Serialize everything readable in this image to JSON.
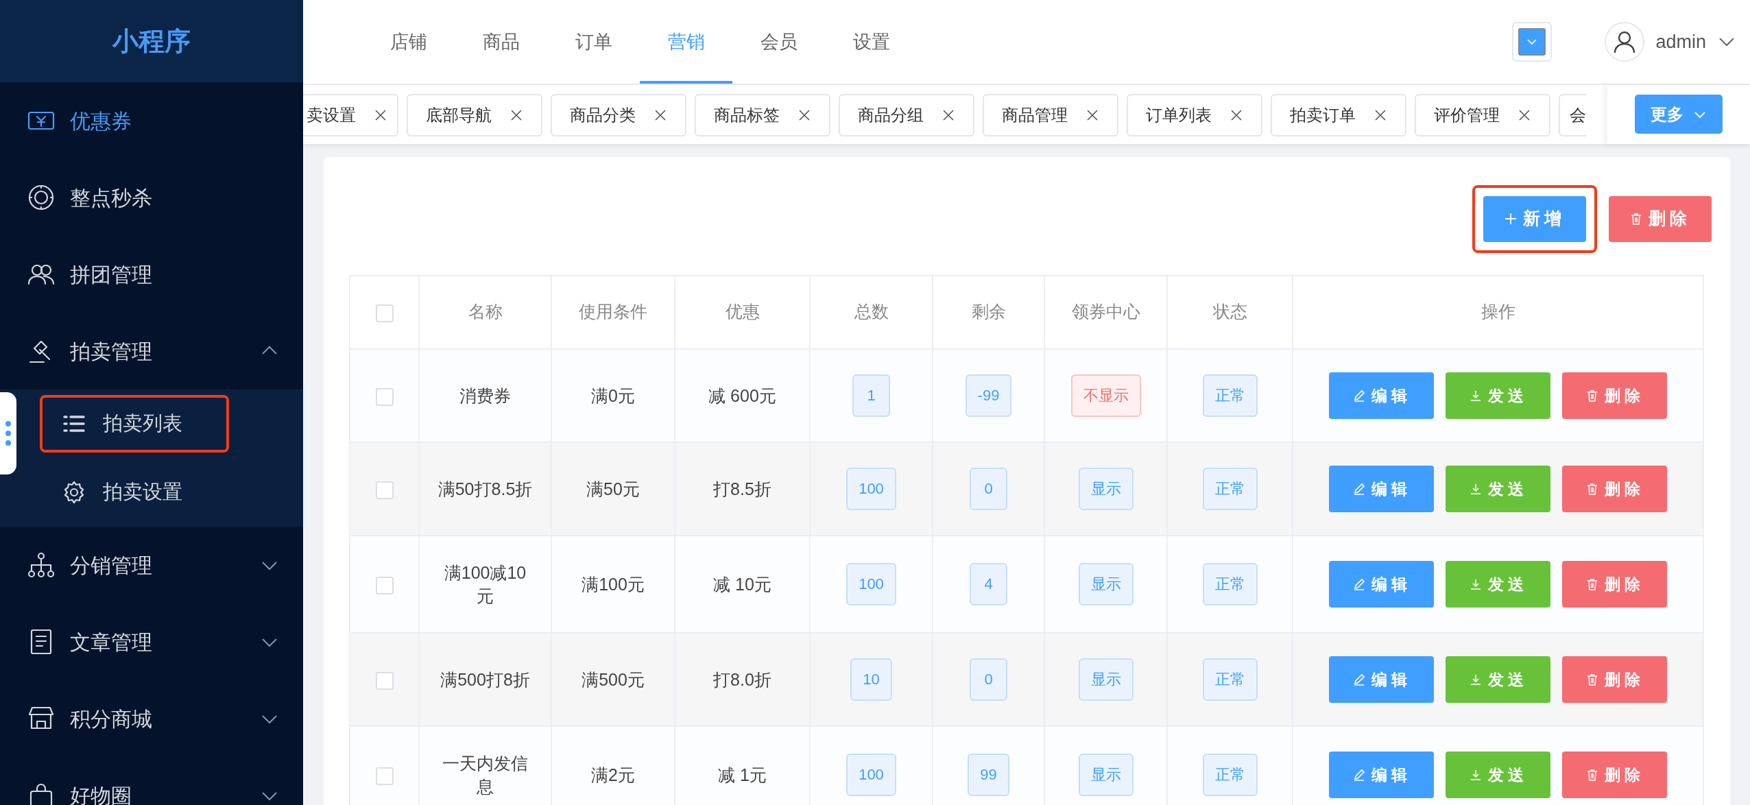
{
  "sidebar": {
    "title": "小程序",
    "items": [
      {
        "label": "优惠券",
        "kind": "link",
        "selected": true
      },
      {
        "label": "整点秒杀",
        "kind": "link",
        "selected": false
      },
      {
        "label": "拼团管理",
        "kind": "link",
        "selected": false
      },
      {
        "label": "拍卖管理",
        "kind": "group",
        "selected": false,
        "expanded": true,
        "children": [
          {
            "label": "拍卖列表",
            "selected": false,
            "highlighted": true
          },
          {
            "label": "拍卖设置",
            "selected": false,
            "highlighted": false
          }
        ]
      },
      {
        "label": "分销管理",
        "kind": "group",
        "selected": false,
        "expanded": false
      },
      {
        "label": "文章管理",
        "kind": "group",
        "selected": false,
        "expanded": false
      },
      {
        "label": "积分商城",
        "kind": "group",
        "selected": false,
        "expanded": false
      },
      {
        "label": "好物圈",
        "kind": "group",
        "selected": false,
        "expanded": false
      }
    ]
  },
  "top_nav": [
    {
      "label": "店铺",
      "selected": false
    },
    {
      "label": "商品",
      "selected": false
    },
    {
      "label": "订单",
      "selected": false
    },
    {
      "label": "营销",
      "selected": true
    },
    {
      "label": "会员",
      "selected": false
    },
    {
      "label": "设置",
      "selected": false
    }
  ],
  "user": {
    "name": "admin"
  },
  "open_tabs": [
    {
      "label": "卖设置"
    },
    {
      "label": "底部导航"
    },
    {
      "label": "商品分类"
    },
    {
      "label": "商品标签"
    },
    {
      "label": "商品分组"
    },
    {
      "label": "商品管理"
    },
    {
      "label": "订单列表"
    },
    {
      "label": "拍卖订单"
    },
    {
      "label": "评价管理"
    },
    {
      "label": "会"
    }
  ],
  "more_button": "更多",
  "toolbar": [
    {
      "label": "新增",
      "kind": "add",
      "highlighted": true
    },
    {
      "label": "删除",
      "kind": "delete",
      "highlighted": false
    }
  ],
  "table": {
    "select_all": false,
    "columns": [
      "名称",
      "使用条件",
      "优惠",
      "总数",
      "剩余",
      "领券中心",
      "状态",
      "操作"
    ],
    "rows": [
      {
        "checked": false,
        "name": "消费券",
        "condition": "满0元",
        "discount": "减 600元",
        "total": "1",
        "remaining": "-99",
        "center": {
          "label": "不显示",
          "visible": false
        },
        "status": "正常",
        "actions": [
          {
            "label": "编辑",
            "kind": "edit"
          },
          {
            "label": "发送",
            "kind": "send"
          },
          {
            "label": "删除",
            "kind": "delete"
          }
        ]
      },
      {
        "checked": false,
        "name": "满50打8.5折",
        "condition": "满50元",
        "discount": "打8.5折",
        "total": "100",
        "remaining": "0",
        "center": {
          "label": "显示",
          "visible": true
        },
        "status": "正常",
        "actions": [
          {
            "label": "编辑",
            "kind": "edit"
          },
          {
            "label": "发送",
            "kind": "send"
          },
          {
            "label": "删除",
            "kind": "delete"
          }
        ]
      },
      {
        "checked": false,
        "name": "满100减10元",
        "condition": "满100元",
        "discount": "减 10元",
        "total": "100",
        "remaining": "4",
        "center": {
          "label": "显示",
          "visible": true
        },
        "status": "正常",
        "actions": [
          {
            "label": "编辑",
            "kind": "edit"
          },
          {
            "label": "发送",
            "kind": "send"
          },
          {
            "label": "删除",
            "kind": "delete"
          }
        ]
      },
      {
        "checked": false,
        "name": "满500打8折",
        "condition": "满500元",
        "discount": "打8.0折",
        "total": "10",
        "remaining": "0",
        "center": {
          "label": "显示",
          "visible": true
        },
        "status": "正常",
        "actions": [
          {
            "label": "编辑",
            "kind": "edit"
          },
          {
            "label": "发送",
            "kind": "send"
          },
          {
            "label": "删除",
            "kind": "delete"
          }
        ]
      },
      {
        "checked": false,
        "name": "一天内发信息",
        "condition": "满2元",
        "discount": "减 1元",
        "total": "100",
        "remaining": "99",
        "center": {
          "label": "显示",
          "visible": true
        },
        "status": "正常",
        "actions": [
          {
            "label": "编辑",
            "kind": "edit"
          },
          {
            "label": "发送",
            "kind": "send"
          },
          {
            "label": "删除",
            "kind": "delete"
          }
        ]
      }
    ]
  }
}
